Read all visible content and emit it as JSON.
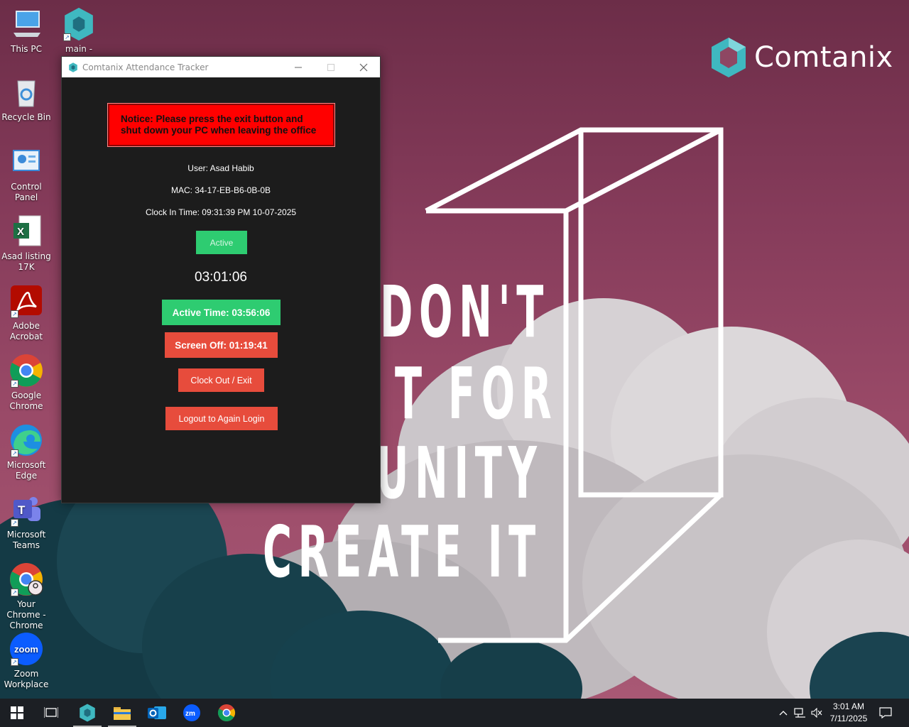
{
  "desktop": {
    "icons": [
      {
        "label": "This PC",
        "icon": "this-pc-icon"
      },
      {
        "label": "main - Shortcut",
        "icon": "comtanix-app-icon"
      },
      {
        "label": "Recycle Bin",
        "icon": "recycle-bin-icon"
      },
      {
        "label": "Control Panel",
        "icon": "control-panel-icon"
      },
      {
        "label": "Asad listing 17K",
        "icon": "excel-file-icon"
      },
      {
        "label": "Adobe Acrobat",
        "icon": "adobe-acrobat-icon"
      },
      {
        "label": "Google Chrome",
        "icon": "chrome-icon"
      },
      {
        "label": "Microsoft Edge",
        "icon": "edge-icon"
      },
      {
        "label": "Microsoft Teams",
        "icon": "teams-icon"
      },
      {
        "label": "Your Chrome - Chrome",
        "icon": "chrome-profile-icon"
      },
      {
        "label": "Zoom Workplace",
        "icon": "zoom-icon"
      }
    ]
  },
  "wallpaper": {
    "brand": "Comtanix",
    "slogan_lines": [
      "DON'T",
      "T FOR",
      "UNITY",
      "CREATE IT"
    ]
  },
  "app": {
    "title": "Comtanix Attendance Tracker",
    "notice": "Notice: Please press the exit button and shut down your PC when leaving the office",
    "user": "User: Asad Habib",
    "mac": "MAC: 34-17-EB-B6-0B-0B",
    "clock_in": "Clock In Time: 09:31:39 PM 10-07-2025",
    "status_label": "Active",
    "timer": "03:01:06",
    "active_time": "Active Time: 03:56:06",
    "screen_off": "Screen Off: 01:19:41",
    "clock_out_label": "Clock Out / Exit",
    "logout_label": "Logout to Again Login"
  },
  "taskbar": {
    "clock_time": "3:01 AM",
    "clock_date": "7/11/2025"
  },
  "colors": {
    "green": "#2ecc71",
    "red_button": "#e74c3c",
    "notice_red": "#ff0000",
    "window_bg": "#1c1c1c",
    "brand_teal": "#3fb8c0"
  }
}
